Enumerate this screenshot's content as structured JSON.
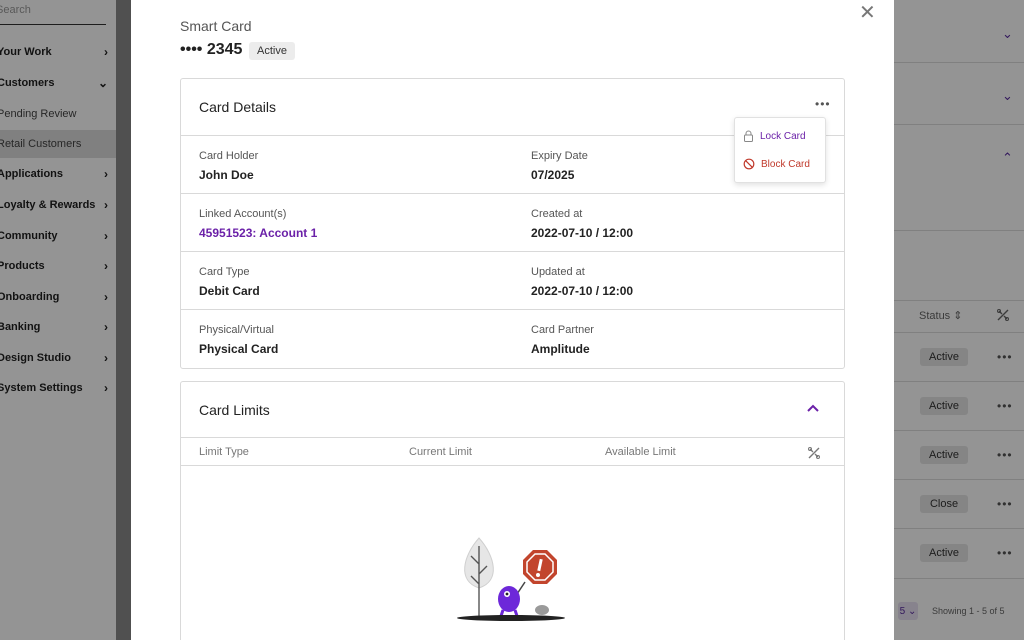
{
  "sidebar": {
    "search_placeholder": "Search",
    "items": [
      {
        "label": "Your Work",
        "chevron": "›"
      },
      {
        "label": "Customers",
        "chevron": "⌄"
      },
      {
        "label": "Pending Review",
        "chevron": ""
      },
      {
        "label": "Retail Customers",
        "chevron": ""
      },
      {
        "label": "Applications",
        "chevron": "›"
      },
      {
        "label": "Loyalty & Rewards",
        "chevron": "›"
      },
      {
        "label": "Community",
        "chevron": "›"
      },
      {
        "label": "Products",
        "chevron": "›"
      },
      {
        "label": "Onboarding",
        "chevron": "›"
      },
      {
        "label": "Banking",
        "chevron": "›"
      },
      {
        "label": "Design Studio",
        "chevron": "›"
      },
      {
        "label": "System Settings",
        "chevron": "›"
      }
    ]
  },
  "background_table": {
    "status_header": "Status ⇕",
    "statuses": [
      "Active",
      "Active",
      "Active",
      "Close",
      "Active"
    ],
    "row_menu": "•••",
    "page_size": "5 ⌄",
    "pagination": "Showing 1 - 5 of 5"
  },
  "modal": {
    "close_glyph": "✕",
    "card_type": "Smart Card",
    "card_number": "•••• 2345",
    "status": "Active",
    "details": {
      "title": "Card Details",
      "more_glyph": "•••",
      "menu": {
        "lock": "Lock Card",
        "block": "Block Card"
      },
      "rows": [
        [
          {
            "label": "Card Holder",
            "value": "John Doe"
          },
          {
            "label": "Expiry Date",
            "value": "07/2025"
          }
        ],
        [
          {
            "label": "Linked Account(s)",
            "value": "45951523: Account 1"
          },
          {
            "label": "Created at",
            "value": "2022-07-10 / 12:00"
          }
        ],
        [
          {
            "label": "Card Type",
            "value": "Debit Card"
          },
          {
            "label": "Updated at",
            "value": "2022-07-10 / 12:00"
          }
        ],
        [
          {
            "label": "Physical/Virtual",
            "value": "Physical Card"
          },
          {
            "label": "Card Partner",
            "value": "Amplitude"
          }
        ]
      ]
    },
    "limits": {
      "title": "Card Limits",
      "columns": [
        "Limit Type",
        "Current Limit",
        "Available Limit"
      ]
    }
  },
  "colors": {
    "accent": "#6b21a8",
    "danger": "#c0392b",
    "illustration_sign": "#c2452d",
    "illustration_creature": "#6d28d9"
  }
}
